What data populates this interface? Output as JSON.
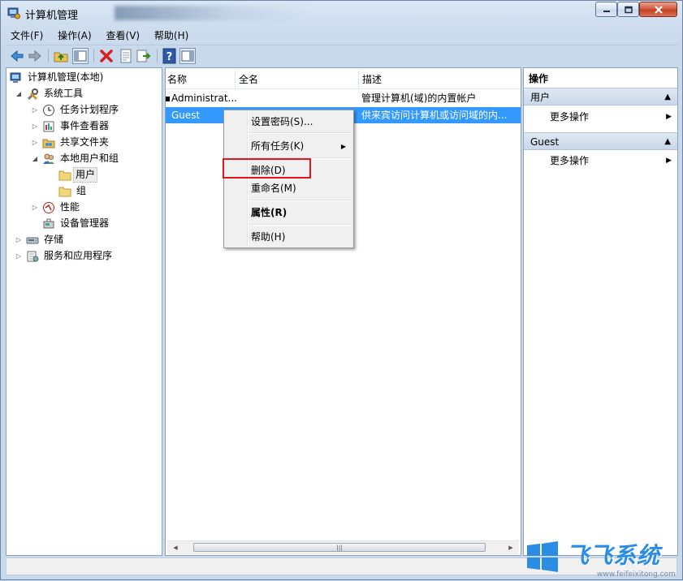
{
  "window": {
    "title": "计算机管理"
  },
  "menubar": [
    "文件(F)",
    "操作(A)",
    "查看(V)",
    "帮助(H)"
  ],
  "toolbar": {
    "icons": [
      "back-icon",
      "forward-icon",
      "up-folder-icon",
      "show-hide-tree-icon",
      "delete-icon",
      "properties-icon",
      "export-icon",
      "help-icon",
      "show-hide-action-pane-icon"
    ]
  },
  "tree": {
    "root": "计算机管理(本地)",
    "system_tools": "系统工具",
    "task_scheduler": "任务计划程序",
    "event_viewer": "事件查看器",
    "shared_folders": "共享文件夹",
    "local_users_groups": "本地用户和组",
    "users": "用户",
    "groups": "组",
    "performance": "性能",
    "device_manager": "设备管理器",
    "storage": "存储",
    "services_apps": "服务和应用程序"
  },
  "list": {
    "columns": [
      "名称",
      "全名",
      "描述"
    ],
    "rows": [
      {
        "name": "Administrat...",
        "fullname": "",
        "description": "管理计算机(域)的内置帐户"
      },
      {
        "name": "Guest",
        "fullname": "",
        "description": "供来宾访问计算机或访问域的内..."
      }
    ]
  },
  "context_menu": {
    "items": [
      "设置密码(S)...",
      "所有任务(K)",
      "删除(D)",
      "重命名(M)",
      "属性(R)",
      "帮助(H)"
    ]
  },
  "actions": {
    "title": "操作",
    "sections": [
      {
        "header": "用户",
        "link": "更多操作"
      },
      {
        "header": "Guest",
        "link": "更多操作"
      }
    ]
  },
  "watermark": {
    "brand": "飞飞系统",
    "url": "www.feifeixitong.com"
  },
  "colors": {
    "selection": "#3399ff",
    "highlight_box": "#e2161d",
    "brand": "#2a8de3"
  }
}
